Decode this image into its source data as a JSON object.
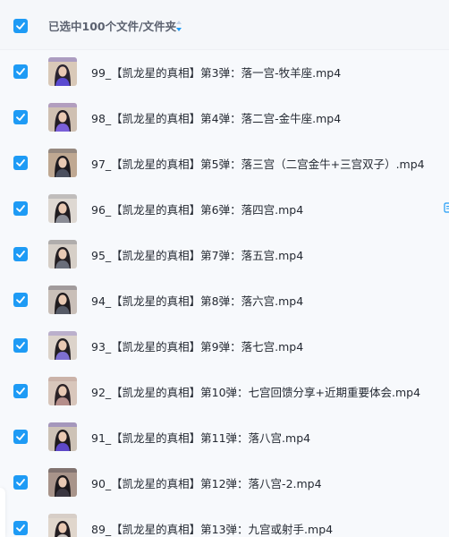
{
  "header": {
    "selection_text": "已选中100个文件/文件夹",
    "sort_icon": "sort-arrows-icon",
    "checked": true
  },
  "colors": {
    "accent": "#1e9bf5",
    "text": "#252a33",
    "muted": "#5c6270"
  },
  "files": [
    {
      "name": "99_【凯龙星的真相】第3弹：落一宫-牧羊座.mp4",
      "checked": true,
      "thumbnail": "video-thumbnail"
    },
    {
      "name": "98_【凯龙星的真相】第4弹：落二宫-金牛座.mp4",
      "checked": true,
      "thumbnail": "video-thumbnail"
    },
    {
      "name": "97_【凯龙星的真相】第5弹：落三宫（二宫金牛+三宫双子）.mp4",
      "checked": true,
      "thumbnail": "video-thumbnail"
    },
    {
      "name": "96_【凯龙星的真相】第6弹：落四宫.mp4",
      "checked": true,
      "thumbnail": "video-thumbnail",
      "row_icon": "copy-icon"
    },
    {
      "name": "95_【凯龙星的真相】第7弹：落五宫.mp4",
      "checked": true,
      "thumbnail": "video-thumbnail"
    },
    {
      "name": "94_【凯龙星的真相】第8弹：落六宫.mp4",
      "checked": true,
      "thumbnail": "video-thumbnail"
    },
    {
      "name": "93_【凯龙星的真相】第9弹：落七宫.mp4",
      "checked": true,
      "thumbnail": "video-thumbnail"
    },
    {
      "name": "92_【凯龙星的真相】第10弹：七宫回馈分享+近期重要体会.mp4",
      "checked": true,
      "thumbnail": "video-thumbnail"
    },
    {
      "name": "91_【凯龙星的真相】第11弹：落八宫.mp4",
      "checked": true,
      "thumbnail": "video-thumbnail"
    },
    {
      "name": "90_【凯龙星的真相】第12弹：落八宫-2.mp4",
      "checked": true,
      "thumbnail": "video-thumbnail"
    },
    {
      "name": "89_【凯龙星的真相】第13弹：九宫或射手.mp4",
      "checked": true,
      "thumbnail": "video-thumbnail"
    }
  ]
}
